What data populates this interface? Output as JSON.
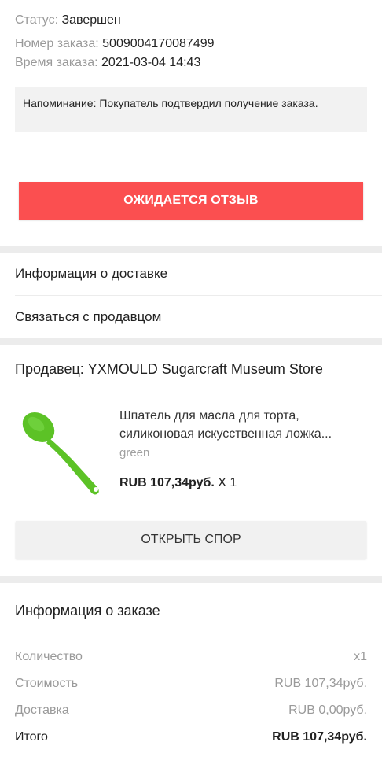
{
  "status": {
    "status_label": "Статус:",
    "status_value": "Завершен",
    "order_no_label": "Номер заказа:",
    "order_no_value": "5009004170087499",
    "order_time_label": "Время заказа:",
    "order_time_value": "2021-03-04 14:43",
    "reminder": "Напоминание: Покупатель подтвердил получение заказа.",
    "review_button": "ОЖИДАЕТСЯ ОТЗЫВ"
  },
  "links": {
    "delivery": "Информация о доставке",
    "contact_seller": "Связаться с продавцом"
  },
  "seller": {
    "title": "Продавец: YXMOULD Sugarcraft Museum Store",
    "product_title_line1": "Шпатель для масла для торта,",
    "product_title_line2": "силиконовая искусственная ложка...",
    "variant": "green",
    "price": "RUB 107,34руб.",
    "quantity": " X 1",
    "dispute_button": "ОТКРЫТЬ СПОР",
    "product_color": "#5cc226"
  },
  "order_info": {
    "title": "Информация о заказе",
    "rows": [
      {
        "label": "Количество",
        "value": "x1"
      },
      {
        "label": "Стоимость",
        "value": "RUB 107,34руб."
      },
      {
        "label": "Доставка",
        "value": "RUB 0,00руб."
      },
      {
        "label": "Итого",
        "value": "RUB 107,34руб."
      }
    ]
  },
  "colors": {
    "accent_red": "#fb4f50",
    "background": "#ececec"
  }
}
